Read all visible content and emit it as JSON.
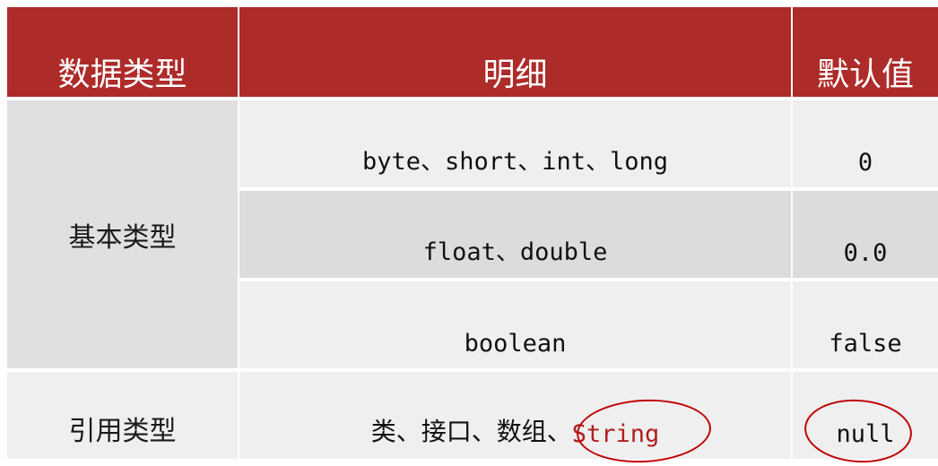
{
  "headers": {
    "type": "数据类型",
    "detail": "明细",
    "default": "默认值"
  },
  "rows": {
    "basic_label": "基本类型",
    "reference_label": "引用类型",
    "integers": {
      "detail": "byte、short、int、long",
      "default": "0"
    },
    "floats": {
      "detail": "float、double",
      "default": "0.0"
    },
    "boolean": {
      "detail": "boolean",
      "default": "false"
    },
    "reference": {
      "detail_prefix": "类、接口、数组、",
      "detail_highlight": "String",
      "default": "null"
    }
  },
  "colors": {
    "header_bg": "#ad2b29",
    "row_light": "#efefef",
    "row_dark": "#dcdcdc",
    "annotation": "#c00000"
  }
}
